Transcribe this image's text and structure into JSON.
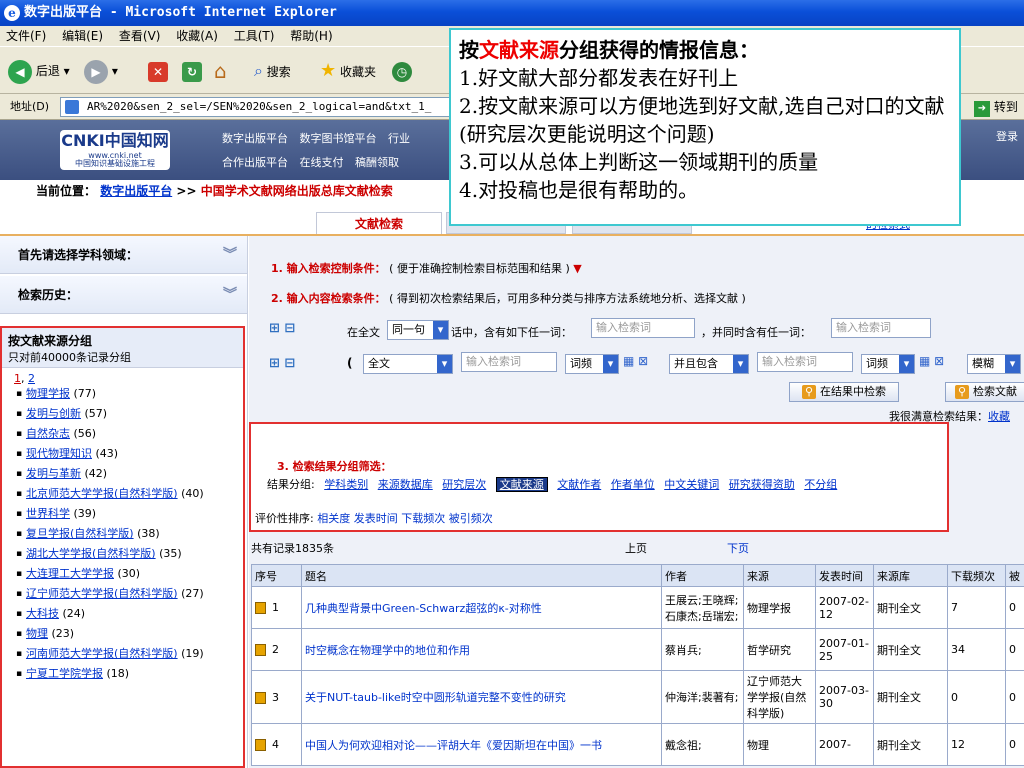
{
  "window": {
    "title": "数字出版平台 - Microsoft Internet Explorer"
  },
  "menu": [
    "文件(F)",
    "编辑(E)",
    "查看(V)",
    "收藏(A)",
    "工具(T)",
    "帮助(H)"
  ],
  "toolbar": {
    "back": "后退",
    "search": "搜索",
    "favorites": "收藏夹"
  },
  "address": {
    "label": "地址(D)",
    "url": "AR%2020&sen_2_sel=/SEN%2020&sen_2_logical=and&txt_1_",
    "go": "转到"
  },
  "site": {
    "logo_main": "CNKI中国知网",
    "logo_url": "www.cnki.net",
    "logo_sub": "中国知识基础设施工程",
    "nav1": [
      "数字出版平台",
      "数字图书馆平台",
      "行业"
    ],
    "nav2": [
      "合作出版平台",
      "在线支付",
      "稿酬领取"
    ],
    "login": "登录"
  },
  "breadcrumb": {
    "label": "当前位置：",
    "link": "数字出版平台",
    "sep": ">>",
    "current": "中国学术文献网络出版总库文献检索"
  },
  "tabs": {
    "active": "文献检索",
    "alt": "的检索式"
  },
  "sidebar": {
    "field_label": "首先请选择学科领域：",
    "history_label": "检索历史：",
    "group_title": "按文献来源分组",
    "group_sub": "只对前40000条记录分组",
    "pages": [
      "1",
      "2"
    ],
    "sources": [
      {
        "name": "物理学报",
        "count": "(77)"
      },
      {
        "name": "发明与创新",
        "count": "(57)"
      },
      {
        "name": "自然杂志",
        "count": "(56)"
      },
      {
        "name": "现代物理知识",
        "count": "(43)"
      },
      {
        "name": "发明与革新",
        "count": "(42)"
      },
      {
        "name": "北京师范大学学报(自然科学版)",
        "count": "(40)"
      },
      {
        "name": "世界科学",
        "count": "(39)"
      },
      {
        "name": "复旦学报(自然科学版)",
        "count": "(38)"
      },
      {
        "name": "湖北大学学报(自然科学版)",
        "count": "(35)"
      },
      {
        "name": "大连理工大学学报",
        "count": "(30)"
      },
      {
        "name": "辽宁师范大学学报(自然科学版)",
        "count": "(27)"
      },
      {
        "name": "大科技",
        "count": "(24)"
      },
      {
        "name": "物理",
        "count": "(23)"
      },
      {
        "name": "河南师范大学学报(自然科学版)",
        "count": "(19)"
      },
      {
        "name": "宁夏工学院学报",
        "count": "(18)"
      }
    ]
  },
  "search": {
    "step1": "1. 输入检索控制条件：",
    "step1_hint": "( 便于准确控制检索目标范围和结果 )",
    "step2": "2. 输入内容检索条件：",
    "step2_hint": "( 得到初次检索结果后，可用多种分类与排序方法系统地分析、选择文献 )",
    "row1_pre": "在全文",
    "row1_sel": "同一句",
    "row1_mid": "话中，含有如下任一词：",
    "row1_and": "，并同时含有任一词：",
    "placeholder": "输入检索词",
    "row2_field": "全文",
    "freq": "词频",
    "and_contains": "并且包含",
    "fuzzy": "模糊",
    "btn_in_results": "在结果中检索",
    "btn_search": "检索文献",
    "satisfied": "我很满意检索结果：",
    "satisfied_link": "收藏"
  },
  "filter": {
    "title": "3. 检索结果分组筛选：",
    "label": "结果分组:",
    "options": [
      "学科类别",
      "来源数据库",
      "研究层次",
      "文献来源",
      "文献作者",
      "作者单位",
      "中文关键词",
      "研究获得资助",
      "不分组"
    ],
    "sort_label": "评价性排序:",
    "sort_options": [
      "相关度",
      "发表时间",
      "下载频次",
      "被引频次"
    ]
  },
  "results": {
    "total": "共有记录1835条",
    "prev": "上页",
    "next": "下页",
    "headers": [
      "序号",
      "题名",
      "作者",
      "来源",
      "发表时间",
      "来源库",
      "下载频次",
      "被"
    ],
    "rows": [
      {
        "no": "1",
        "title": "几种典型背景中Green-Schwarz超弦的κ-对称性",
        "author": "王展云;王晓辉;石康杰;岳瑞宏;",
        "source": "物理学报",
        "date": "2007-02-12",
        "db": "期刊全文",
        "downloads": "7",
        "cited": "0"
      },
      {
        "no": "2",
        "title": "时空概念在物理学中的地位和作用",
        "author": "蔡肖兵;",
        "source": "哲学研究",
        "date": "2007-01-25",
        "db": "期刊全文",
        "downloads": "34",
        "cited": "0"
      },
      {
        "no": "3",
        "title": "关于NUT-taub-like时空中圆形轨道完整不变性的研究",
        "author": "仲海洋;裴著有;",
        "source": "辽宁师范大学学报(自然科学版)",
        "date": "2007-03-30",
        "db": "期刊全文",
        "downloads": "0",
        "cited": "0"
      },
      {
        "no": "4",
        "title": "中国人为何欢迎相对论——评胡大年《爱因斯坦在中国》一书",
        "author": "戴念祖;",
        "source": "物理",
        "date": "2007-",
        "db": "期刊全文",
        "downloads": "12",
        "cited": "0"
      }
    ]
  },
  "callout": {
    "prefix": "按",
    "highlight": "文献来源",
    "suffix": "分组获得的情报信息：",
    "lines": [
      "1.好文献大部分都发表在好刊上",
      "2.按文献来源可以方便地选到好文献,选自己对口的文献(研究层次更能说明这个问题)",
      "3.可以从总体上判断这一领域期刊的质量",
      "4.对投稿也是很有帮助的。"
    ]
  }
}
